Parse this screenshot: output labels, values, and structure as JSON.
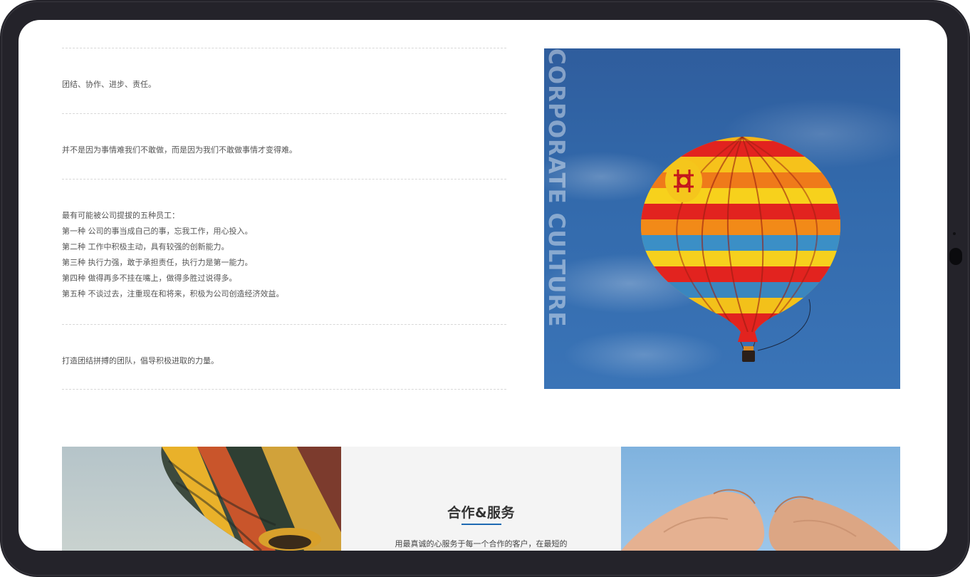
{
  "culture": {
    "items": [
      {
        "lines": [
          "团结、协作、进步、责任。"
        ]
      },
      {
        "lines": [
          "并不是因为事情难我们不敢做，而是因为我们不敢做事情才变得难。"
        ]
      },
      {
        "lines": [
          "最有可能被公司提拔的五种员工：",
          "第一种  公司的事当成自己的事，忘我工作，用心投入。",
          "第二种  工作中积极主动，具有较强的创新能力。",
          "第三种  执行力强，敢于承担责任，执行力是第一能力。",
          "第四种  做得再多不挂在嘴上，做得多胜过说得多。",
          "第五种  不谈过去，注重现在和将来，积极为公司创造经济效益。"
        ]
      },
      {
        "lines": [
          "打造团结拼搏的团队，倡导积极进取的力量。"
        ]
      }
    ],
    "image_caption": "CORPORATE CULTURE"
  },
  "service": {
    "title": "合作&服务",
    "description": "用最真诚的心服务于每一个合作的客户，在最短的"
  },
  "colors": {
    "frame": "#24232a",
    "accent": "#1e6ab3",
    "sky": "#3269ab",
    "text": "#555555"
  }
}
